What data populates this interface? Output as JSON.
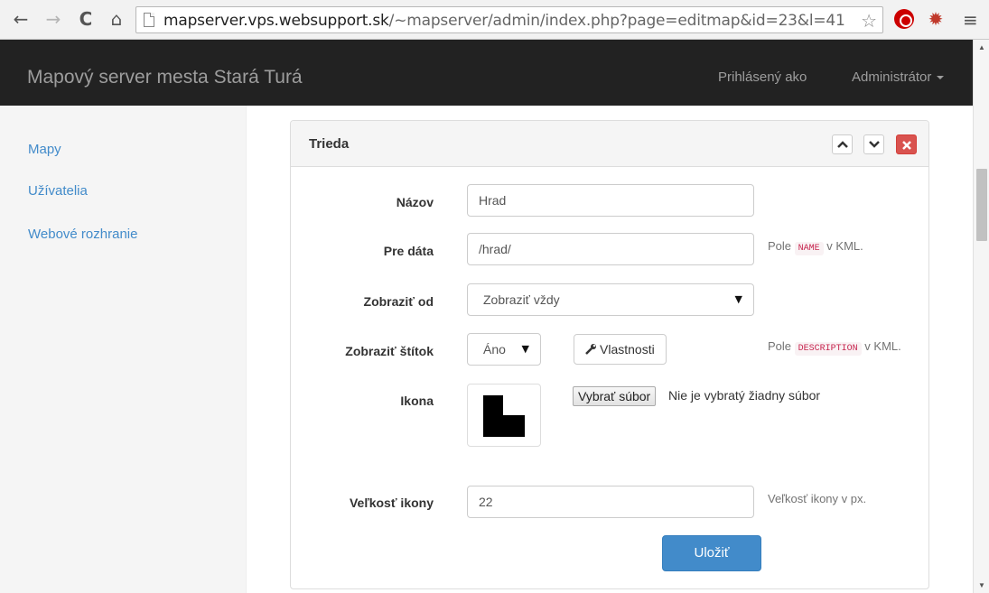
{
  "browser": {
    "back_icon": "←",
    "forward_icon": "→",
    "reload_icon": "C",
    "home_icon": "⌂",
    "url_host": "mapserver.vps.websupport.sk",
    "url_path": "/~mapserver/admin/index.php?page=editmap&id=23&l=41",
    "star_icon": "☆",
    "menu_icon": "≡",
    "bug_icon": "✹"
  },
  "navbar": {
    "brand": "Mapový server mesta Stará Turá",
    "login_label": "Prihlásený ako",
    "user": "Administrátor"
  },
  "sidebar": {
    "items": [
      {
        "label": "Mapy"
      },
      {
        "label": "Užívatelia"
      },
      {
        "label": "Webové rozhranie"
      }
    ]
  },
  "panel": {
    "title": "Trieda"
  },
  "form": {
    "name": {
      "label": "Názov",
      "value": "Hrad"
    },
    "data": {
      "label": "Pre dáta",
      "value": "/hrad/",
      "help_prefix": "Pole",
      "help_code": "NAME",
      "help_suffix": "v KML."
    },
    "show_from": {
      "label": "Zobraziť od",
      "value": "Zobraziť vždy"
    },
    "show_label": {
      "label": "Zobraziť štítok",
      "value": "Áno",
      "properties_button": "Vlastnosti",
      "help_prefix": "Pole",
      "help_code": "DESCRIPTION",
      "help_suffix": "v KML."
    },
    "icon": {
      "label": "Ikona",
      "file_button": "Vybrať súbor",
      "file_status": "Nie je vybratý žiadny súbor"
    },
    "icon_size": {
      "label": "Veľkosť ikony",
      "value": "22",
      "help": "Veľkosť ikony v px."
    },
    "save_button": "Uložiť"
  }
}
